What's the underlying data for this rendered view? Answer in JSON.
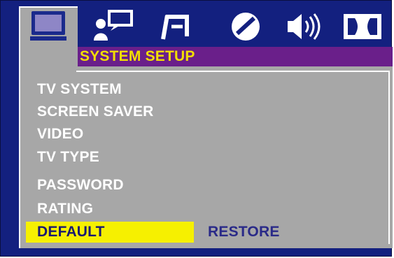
{
  "title": "SYSTEM SETUP",
  "tabs": [
    {
      "icon": "monitor-icon",
      "selected": true
    },
    {
      "icon": "person-speech-icon",
      "selected": false
    },
    {
      "icon": "music-note-icon",
      "selected": false
    },
    {
      "icon": "disc-icon",
      "selected": false
    },
    {
      "icon": "speaker-icon",
      "selected": false
    },
    {
      "icon": "dolby-icon",
      "selected": false
    }
  ],
  "menu": {
    "items": [
      "TV SYSTEM",
      "SCREEN SAVER",
      "VIDEO",
      "TV TYPE",
      "PASSWORD",
      "RATING",
      "DEFAULT"
    ],
    "selected_index": 6,
    "selected_option": "RESTORE"
  },
  "colors": {
    "background": "#13207f",
    "panel": "#a7a7a7",
    "title_bar": "#6a1f8a",
    "title_text": "#f2df00",
    "highlight": "#f6f000",
    "menu_text": "#ffffff"
  }
}
